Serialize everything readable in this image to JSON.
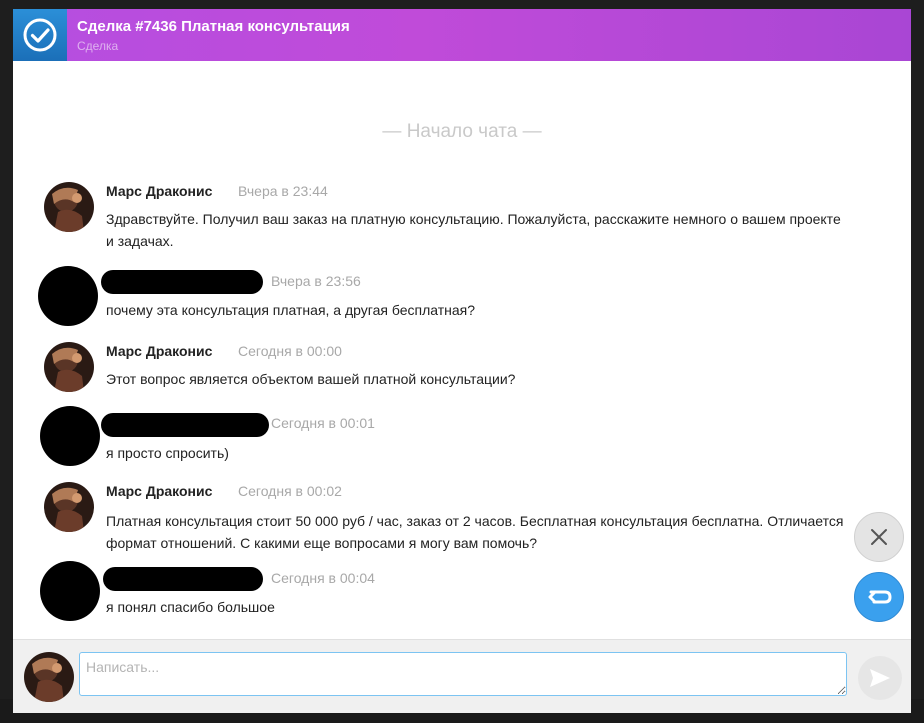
{
  "header": {
    "title": "Сделка #7436 Платная консультация",
    "subtitle": "Сделка",
    "icon": "check-circle-icon"
  },
  "chat": {
    "start_label": "— Начало чата —",
    "messages": [
      {
        "author": "Марс Драконис",
        "time": "Вчера в 23:44",
        "text": "Здравствуйте. Получил ваш заказ на платную консультацию. Пожалуйста, расскажите немного о вашем проекте и задачах."
      },
      {
        "author": "",
        "time": "Вчера в 23:56",
        "text": "почему эта консультация платная, а другая бесплатная?"
      },
      {
        "author": "Марс Драконис",
        "time": "Сегодня в 00:00",
        "text": "Этот вопрос является объектом вашей платной консультации?"
      },
      {
        "author": "",
        "time": "Сегодня в 00:01",
        "text": "я просто спросить)"
      },
      {
        "author": "Марс Драконис",
        "time": "Сегодня в 00:02",
        "text": "Платная консультация стоит 50 000 руб / час, заказ от 2 часов. Бесплатная консультация бесплатна. Отличается формат отношений. С какими еще вопросами я могу вам помочь?"
      },
      {
        "author": "",
        "time": "Сегодня в 00:04",
        "text": "я понял спасибо большое"
      }
    ]
  },
  "compose": {
    "placeholder": "Написать..."
  },
  "colors": {
    "header_gradient_start": "#b54ee0",
    "header_icon_bg": "#2b8fd8",
    "reply_button": "#3aa0ee",
    "redacted": "#000000"
  }
}
